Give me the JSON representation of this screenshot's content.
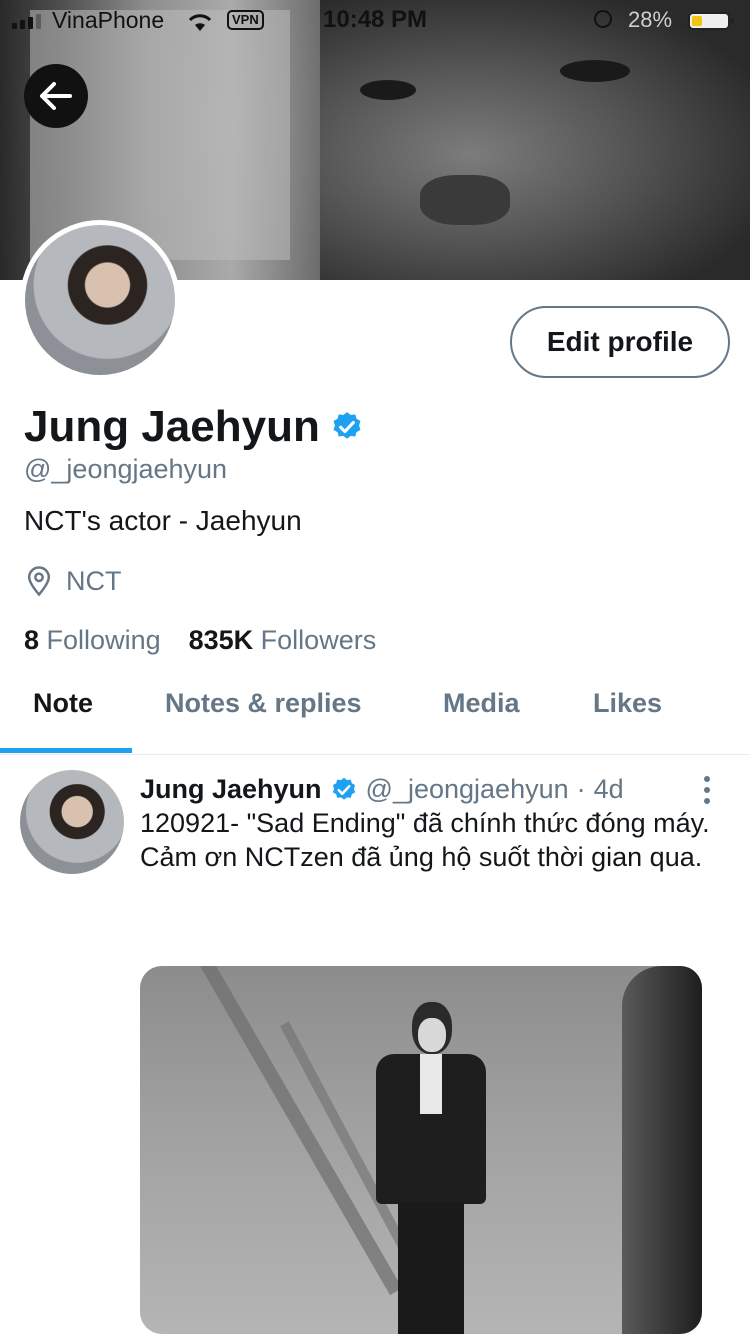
{
  "status_bar": {
    "carrier": "VinaPhone",
    "vpn": "VPN",
    "time": "10:48 PM",
    "battery": "28%"
  },
  "profile": {
    "name": "Jung Jaehyun",
    "handle": "@_jeongjaehyun",
    "bio": "NCT's actor - Jaehyun",
    "location": "NCT",
    "following_count": "8",
    "following_label": "Following",
    "followers_count": "835K",
    "followers_label": "Followers",
    "edit_label": "Edit profile",
    "verified_color": "#1da1f2"
  },
  "tabs": [
    {
      "label": "Note",
      "active": true
    },
    {
      "label": "Notes & replies",
      "active": false
    },
    {
      "label": "Media",
      "active": false
    },
    {
      "label": "Likes",
      "active": false
    }
  ],
  "tweet": {
    "name": "Jung Jaehyun",
    "handle": "@_jeongjaehyun",
    "separator": "·",
    "time": "4d",
    "lines": [
      "120921- \"Sad Ending\" đã chính thức đóng máy.",
      "Cảm ơn NCTzen đã ủng hộ suốt thời gian qua."
    ]
  },
  "colors": {
    "accent": "#1da1f2",
    "secondary_text": "#657786",
    "primary_text": "#14171a"
  }
}
